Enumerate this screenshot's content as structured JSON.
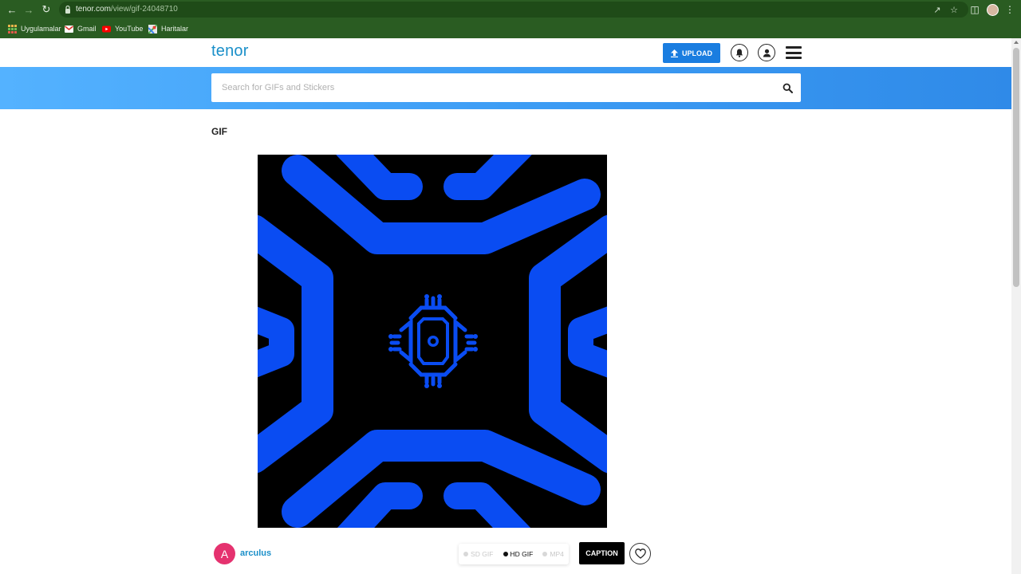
{
  "browser": {
    "url_host": "tenor.com",
    "url_path": "/view/gif-24048710",
    "bookmarks": [
      {
        "label": "Uygulamalar",
        "icon": "apps-grid-icon"
      },
      {
        "label": "Gmail",
        "icon": "gmail-icon"
      },
      {
        "label": "YouTube",
        "icon": "youtube-icon"
      },
      {
        "label": "Haritalar",
        "icon": "maps-icon"
      }
    ]
  },
  "header": {
    "logo": "tenor",
    "upload_label": "UPLOAD"
  },
  "search": {
    "placeholder": "Search for GIFs and Stickers"
  },
  "content": {
    "section_label": "GIF",
    "gif_colors": {
      "background": "#000000",
      "shape": "#0a4cf2"
    }
  },
  "footer_row": {
    "avatar_initial": "A",
    "avatar_color": "#e5326f",
    "username": "arculus",
    "formats": [
      {
        "label": "SD GIF",
        "selected": false
      },
      {
        "label": "HD GIF",
        "selected": true
      },
      {
        "label": "MP4",
        "selected": false
      }
    ],
    "caption_label": "CAPTION"
  }
}
